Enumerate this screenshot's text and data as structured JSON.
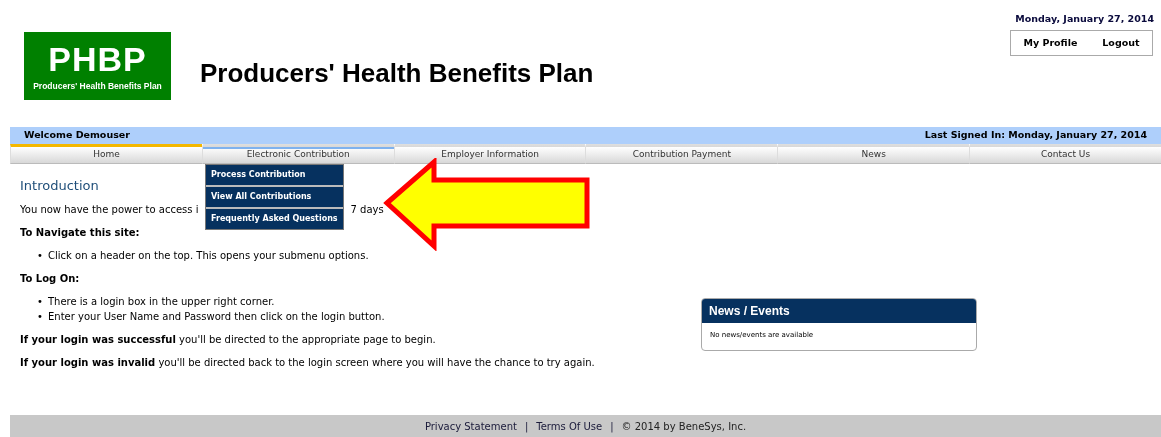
{
  "logo": {
    "initials": "PHBP",
    "tagline": "Producers' Health Benefits Plan"
  },
  "site_title": "Producers' Health Benefits Plan",
  "header_date": "Monday, January 27, 2014",
  "user_links": [
    "My Profile",
    "Logout"
  ],
  "welcome_bar": {
    "welcome": "Welcome Demouser",
    "last_signed_in": "Last Signed In: Monday, January 27, 2014"
  },
  "tabs": [
    {
      "label": "Home",
      "selected": true,
      "expanded": false
    },
    {
      "label": "Electronic Contribution",
      "selected": false,
      "expanded": true,
      "submenu": [
        "Process Contribution",
        "View All Contributions",
        "Frequently Asked Questions"
      ]
    },
    {
      "label": "Employer Information",
      "selected": false,
      "expanded": false
    },
    {
      "label": "Contribution Payment",
      "selected": false,
      "expanded": false
    },
    {
      "label": "News",
      "selected": false,
      "expanded": false
    },
    {
      "label": "Contact Us",
      "selected": false,
      "expanded": false
    }
  ],
  "content": [
    {
      "kind": "heading",
      "text": "Introduction"
    },
    {
      "kind": "split",
      "parts": [
        "You now have the power to access i",
        "7 days"
      ]
    },
    {
      "kind": "subheading",
      "text": "To Navigate this site:"
    },
    {
      "kind": "bullets",
      "items": [
        {
          "marker": "•",
          "text": "Click on a header on the top. This opens your submenu options."
        }
      ]
    },
    {
      "kind": "subheading",
      "text": "To Log On:"
    },
    {
      "kind": "bullets",
      "items": [
        {
          "marker": "•",
          "text": "There is a login box in the upper right corner."
        },
        {
          "marker": "•",
          "text": "Enter your User Name and Password then click on the login button."
        }
      ]
    },
    {
      "kind": "paragraph",
      "text": "**If your login was successful** you'll be directed to the appropriate page to begin."
    },
    {
      "kind": "paragraph",
      "text": "**If your login was invalid** you'll be directed back to the login screen where you will have the chance to try again."
    }
  ],
  "news_panel": {
    "title": "News / Events",
    "message": "No news/events are available"
  },
  "footer": [
    {
      "kind": "link",
      "text": "Privacy Statement"
    },
    {
      "kind": "separator",
      "text": "|"
    },
    {
      "kind": "link",
      "text": "Terms Of Use"
    },
    {
      "kind": "separator",
      "text": "|"
    },
    {
      "kind": "text",
      "text": "© 2014 by BeneSys, Inc."
    }
  ]
}
